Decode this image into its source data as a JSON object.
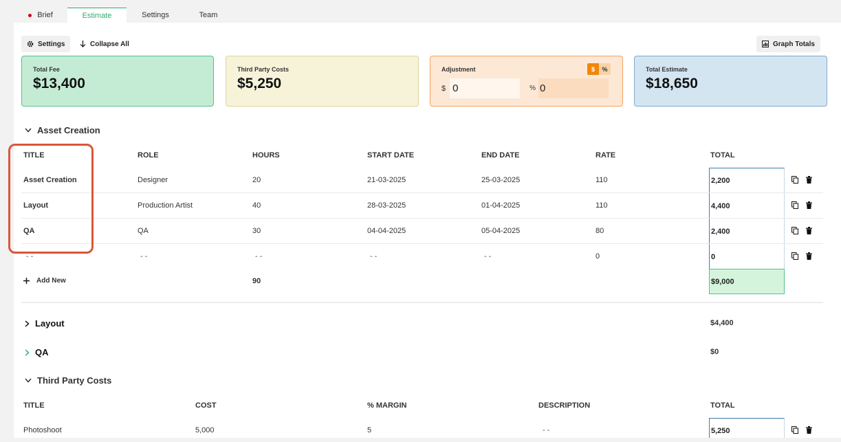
{
  "tabs": [
    {
      "label": "Brief"
    },
    {
      "label": "Estimate"
    },
    {
      "label": "Settings"
    },
    {
      "label": "Team"
    }
  ],
  "toolbar": {
    "settings_label": "Settings",
    "collapse_label": "Collapse All",
    "graph_label": "Graph Totals"
  },
  "summary": {
    "total_fee": {
      "label": "Total Fee",
      "value": "$13,400"
    },
    "third_party": {
      "label": "Third Party Costs",
      "value": "$5,250"
    },
    "adjustment": {
      "label": "Adjustment",
      "toggle_dollar": "$",
      "toggle_percent": "%",
      "currency_symbol": "$",
      "amount_value": "0",
      "percent_symbol": "%",
      "percent_value": "0"
    },
    "total_estimate": {
      "label": "Total Estimate",
      "value": "$18,650"
    }
  },
  "asset_creation": {
    "title": "Asset Creation",
    "headers": {
      "title": "TITLE",
      "role": "ROLE",
      "hours": "HOURS",
      "start": "START DATE",
      "end": "END DATE",
      "rate": "RATE",
      "total": "TOTAL"
    },
    "rows": [
      {
        "title": "Asset Creation",
        "role": "Designer",
        "hours": "20",
        "start": "21-03-2025",
        "end": "25-03-2025",
        "rate": "110",
        "total": "2,200"
      },
      {
        "title": "Layout",
        "role": "Production Artist",
        "hours": "40",
        "start": "28-03-2025",
        "end": "01-04-2025",
        "rate": "110",
        "total": "4,400"
      },
      {
        "title": "QA",
        "role": "QA",
        "hours": "30",
        "start": "04-04-2025",
        "end": "05-04-2025",
        "rate": "80",
        "total": "2,400"
      },
      {
        "title": "--",
        "role": "--",
        "hours": "--",
        "start": "--",
        "end": "--",
        "rate": "0",
        "total": "0"
      }
    ],
    "add_new_label": "Add New",
    "hours_sum": "90",
    "total_sum": "$9,000"
  },
  "layout_section": {
    "title": "Layout",
    "total": "$4,400"
  },
  "qa_section": {
    "title": "QA",
    "total": "$0"
  },
  "third_party_costs": {
    "title": "Third Party Costs",
    "headers": {
      "title": "TITLE",
      "cost": "COST",
      "margin": "% MARGIN",
      "description": "DESCRIPTION",
      "total": "TOTAL"
    },
    "rows": [
      {
        "title": "Photoshoot",
        "cost": "5,000",
        "margin": "5",
        "description": "--",
        "total": "5,250"
      }
    ]
  },
  "colors": {
    "accent_green": "#2fae6d",
    "highlight_red": "#d9563a",
    "adjustment_orange": "#f0870a"
  }
}
